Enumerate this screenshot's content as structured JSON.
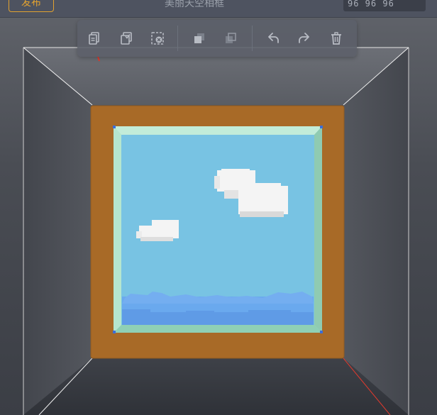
{
  "header": {
    "publish_label": "发布",
    "scene_title": "美丽天空相框",
    "size_value": "96  96  96"
  },
  "toolbar": {
    "buttons": [
      {
        "name": "copy-button",
        "icon": "copy-icon"
      },
      {
        "name": "paste-button",
        "icon": "paste-check-icon"
      },
      {
        "name": "clear-selection-button",
        "icon": "clear-selection-icon"
      },
      {
        "name": "bring-forward-button",
        "icon": "bring-forward-icon"
      },
      {
        "name": "send-backward-button",
        "icon": "send-backward-icon"
      },
      {
        "name": "undo-button",
        "icon": "undo-icon"
      },
      {
        "name": "redo-button",
        "icon": "redo-icon"
      },
      {
        "name": "delete-button",
        "icon": "trash-icon"
      }
    ]
  },
  "colors": {
    "frame_wood": "#a86a27",
    "frame_mat": "#a9dfc7",
    "sky": "#78c3e3",
    "ground_blue": "#5f9be6",
    "accent": "#e2a230",
    "axis_red": "#e03a2e"
  }
}
